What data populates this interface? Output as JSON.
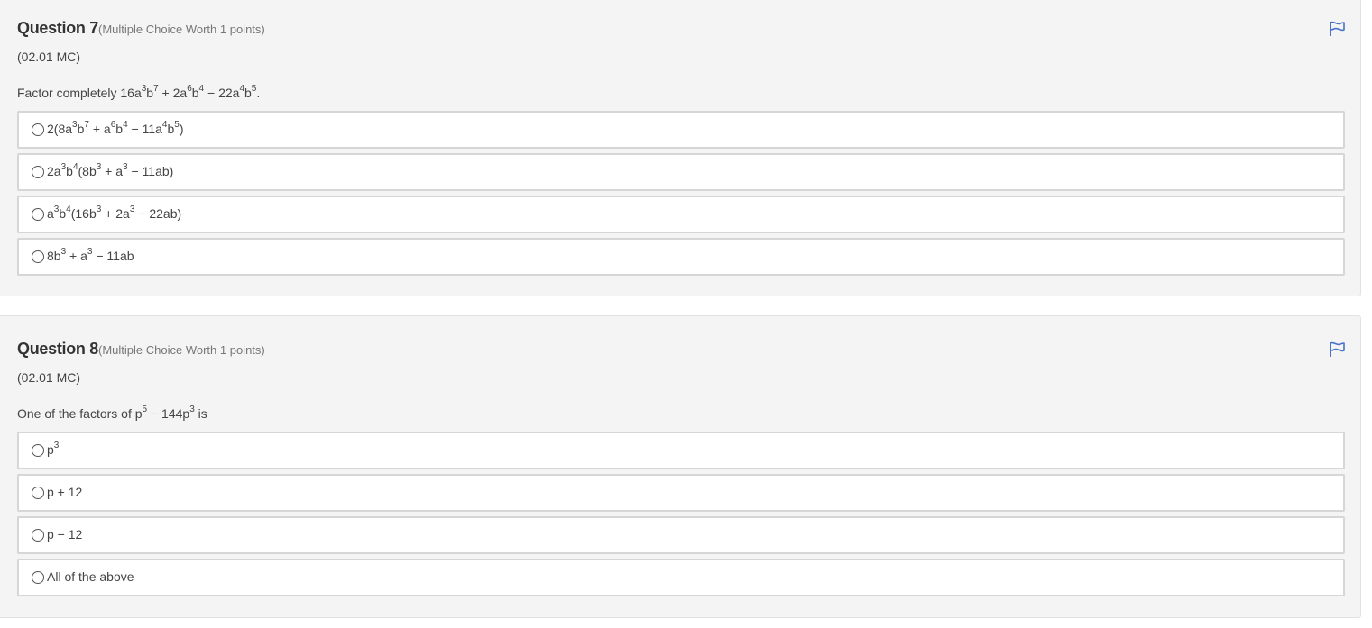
{
  "questions": [
    {
      "title": "Question 7",
      "worth": "(Multiple Choice Worth 1 points)",
      "code": "(02.01 MC)",
      "prompt": [
        "Factor completely 16a",
        "3",
        "b",
        "7",
        " + 2a",
        "6",
        "b",
        "4",
        " − 22a",
        "4",
        "b",
        "5",
        "."
      ],
      "options": [
        [
          "2(8a",
          "3",
          "b",
          "7",
          " + a",
          "6",
          "b",
          "4",
          " − 11a",
          "4",
          "b",
          "5",
          ")"
        ],
        [
          "2a",
          "3",
          "b",
          "4",
          "(8b",
          "3",
          " + a",
          "3",
          " − 11ab)"
        ],
        [
          "a",
          "3",
          "b",
          "4",
          "(16b",
          "3",
          " + 2a",
          "3",
          " − 22ab)"
        ],
        [
          "8b",
          "3",
          " + a",
          "3",
          " − 11ab"
        ]
      ]
    },
    {
      "title": "Question 8",
      "worth": "(Multiple Choice Worth 1 points)",
      "code": "(02.01 MC)",
      "prompt": [
        "One of the factors of p",
        "5",
        " − 144p",
        "3",
        " is"
      ],
      "options": [
        [
          "p",
          "3"
        ],
        [
          "p + 12"
        ],
        [
          "p − 12"
        ],
        [
          "All of the above"
        ]
      ]
    }
  ],
  "icons": {
    "flag": "flag-icon",
    "radio": "radio-button"
  },
  "colors": {
    "flag": "#4a72c9",
    "card_bg": "#f4f4f4",
    "answer_border": "#d6d6d6"
  }
}
